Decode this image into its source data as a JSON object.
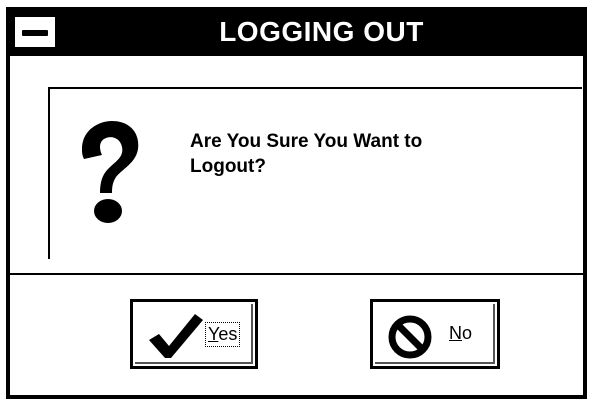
{
  "window": {
    "title": "LOGGING OUT"
  },
  "dialog": {
    "icon": "question-icon",
    "message_line1": "Are You Sure You Want to",
    "message_line2": "Logout?"
  },
  "buttons": {
    "yes": {
      "icon": "checkmark-icon",
      "mnemonic": "Y",
      "rest": "es"
    },
    "no": {
      "icon": "no-symbol-icon",
      "mnemonic": "N",
      "rest": "o"
    }
  }
}
